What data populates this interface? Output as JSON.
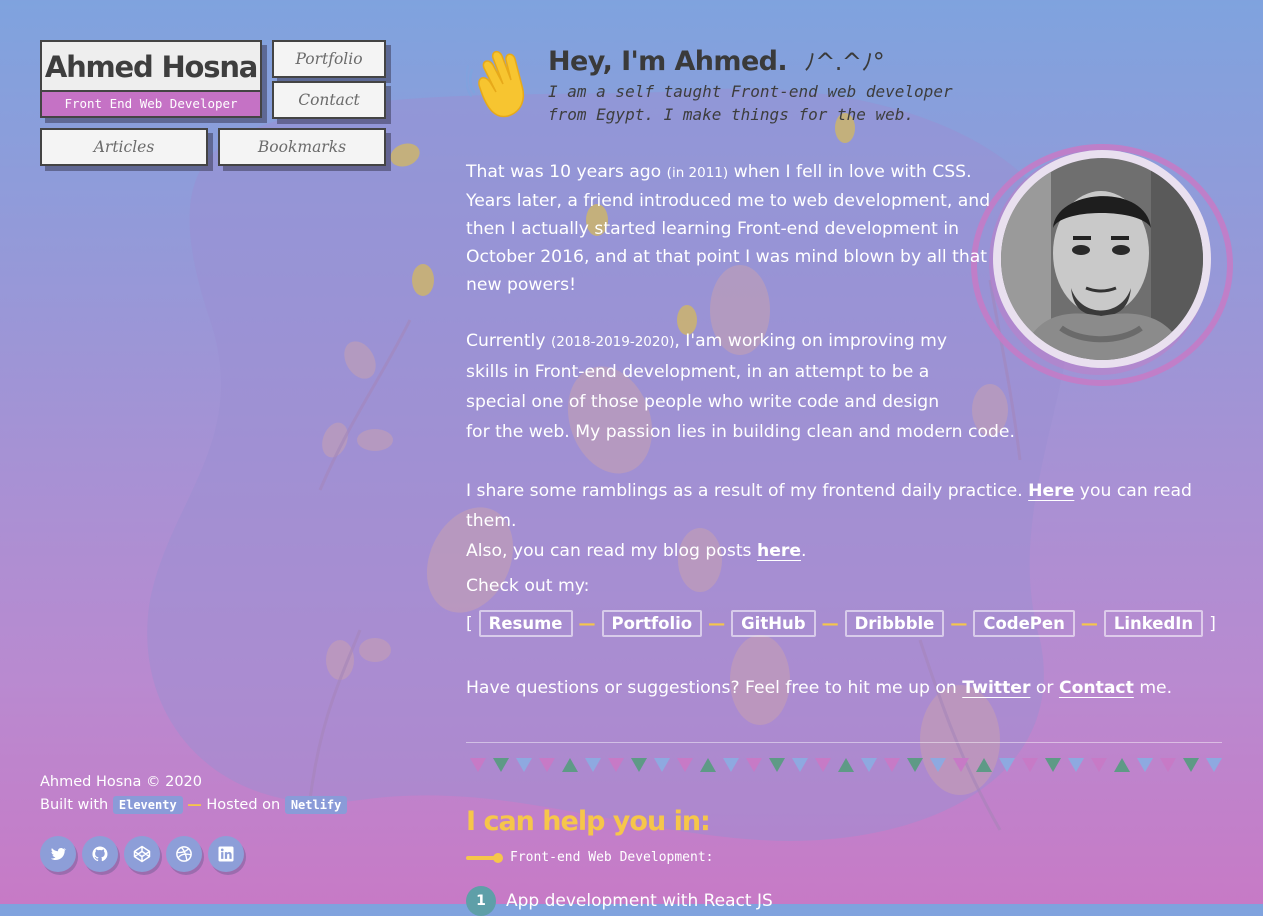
{
  "brand": {
    "name": "Ahmed Hosna",
    "role": "Front End Web Developer"
  },
  "nav": {
    "portfolio": "Portfolio",
    "contact": "Contact",
    "articles": "Articles",
    "bookmarks": "Bookmarks"
  },
  "greeting": {
    "title": "Hey, I'm Ahmed.",
    "emoticon": "ﾉ^.^ﾉ°",
    "subtitle_line1": "I am a self taught Front-end web developer",
    "subtitle_line2": "from Egypt. I make things for the web.",
    "emoji": "👋"
  },
  "intro": {
    "p1_a": "That was 10 years ago",
    "p1_small": "(in 2011)",
    "p1_b": "when I fell in love with CSS.",
    "p1_l2": "Years later, a friend introduced me to web development, and",
    "p1_l3": "then I actually started learning Front-end development in",
    "p1_l4": "October 2016, and at that point I was mind blown by all that",
    "p1_l5": "new powers!",
    "p2_a": "Currently",
    "p2_small": "(2018-2019-2020)",
    "p2_b": ", I'am working on improving my",
    "p2_l2": "skills in Front-end development, in an attempt to be a",
    "p2_l3": "special one of those people who write code and design",
    "p2_l4": "for the web. My passion lies in building clean and modern code.",
    "p3_a": "I share some ramblings as a result of my frontend daily practice.",
    "p3_link1": "Here",
    "p3_b": "you can read them.",
    "p3_c": "Also, you can read my blog posts",
    "p3_link2": "here",
    "p3_end": ".",
    "checkout": "Check out my:",
    "bracket_open": "[",
    "bracket_close": "]",
    "links": [
      "Resume",
      "Portfolio",
      "GitHub",
      "Dribbble",
      "CodePen",
      "LinkedIn"
    ],
    "sep": "—",
    "contact_a": "Have questions or suggestions? Feel free to hit me up on",
    "contact_twitter": "Twitter",
    "contact_or": "or",
    "contact_link": "Contact",
    "contact_end": "me."
  },
  "help": {
    "title": "I can help you in:",
    "subtitle": "Front-end Web Development:",
    "items": [
      {
        "num": "1",
        "label": "App development with React JS"
      }
    ]
  },
  "footer": {
    "copyright": "Ahmed Hosna © 2020",
    "built_with": "Built with",
    "eleventy": "Eleventy",
    "dash": "—",
    "hosted_on": "Hosted on",
    "netlify": "Netlify"
  },
  "socials": [
    "twitter-icon",
    "github-icon",
    "codepen-icon",
    "dribbble-icon",
    "linkedin-icon"
  ],
  "colors": {
    "accent_yellow": "#f6c64a",
    "brand_pink": "#c572c5",
    "tag_blue": "#8a9bd8",
    "num_teal": "#5e9fa8"
  }
}
